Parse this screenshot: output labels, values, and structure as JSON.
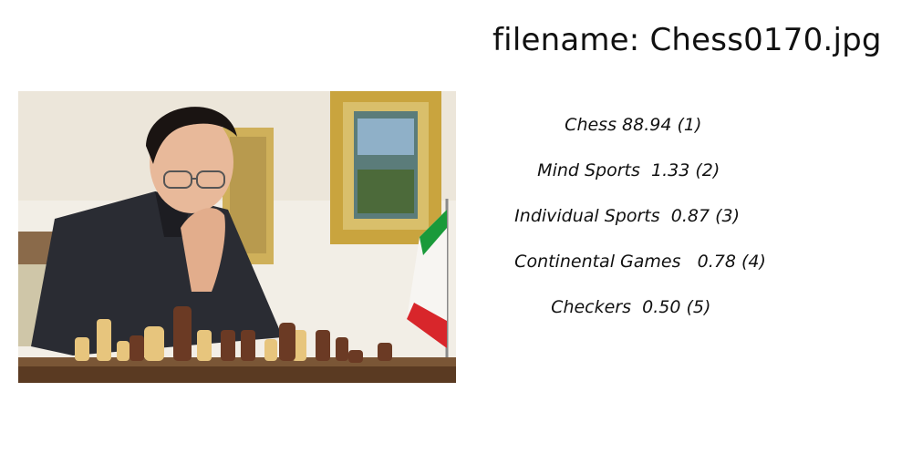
{
  "header": {
    "filename_prefix": "filename: ",
    "filename": "Chess0170.jpg"
  },
  "image": {
    "icon": "chess-photo",
    "description_hidden": true
  },
  "predictions": [
    {
      "label": "Chess",
      "score": "88.94",
      "rank": "(1)"
    },
    {
      "label": "Mind Sports",
      "score": "1.33",
      "rank": "(2)"
    },
    {
      "label": "Individual Sports",
      "score": "0.87",
      "rank": "(3)"
    },
    {
      "label": "Continental Games",
      "score": "0.78",
      "rank": "(4)"
    },
    {
      "label": "Checkers",
      "score": "0.50",
      "rank": "(5)"
    }
  ],
  "colors": {
    "flag_green": "#1a9a3a",
    "flag_red": "#d8262b",
    "board": "#5a3a22",
    "frame_gold": "#c9a43e"
  }
}
